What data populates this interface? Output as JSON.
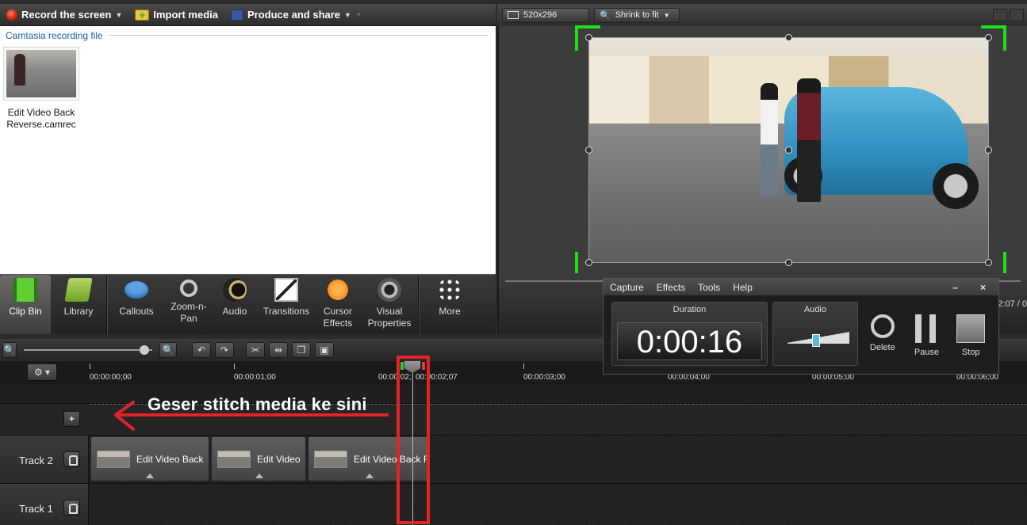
{
  "menubar": {
    "record_label": "Record the screen",
    "import_label": "Import media",
    "produce_label": "Produce and share"
  },
  "clipbin": {
    "header": "Camtasia recording file",
    "items": [
      {
        "name": "Edit Video Back Reverse.camrec"
      }
    ]
  },
  "tasks": [
    {
      "label": "Clip Bin",
      "icon": "film-strip-icon",
      "active": true
    },
    {
      "label": "Library",
      "icon": "library-folder-icon"
    },
    {
      "label": "Callouts",
      "icon": "callout-bubble-icon"
    },
    {
      "label": "Zoom-n-Pan",
      "icon": "magnifier-icon"
    },
    {
      "label": "Audio",
      "icon": "speaker-icon"
    },
    {
      "label": "Transitions",
      "icon": "transitions-icon"
    },
    {
      "label": "Cursor Effects",
      "icon": "cursor-icon"
    },
    {
      "label": "Visual Properties",
      "icon": "visual-properties-icon"
    },
    {
      "label": "More",
      "icon": "more-dots-icon"
    }
  ],
  "preview": {
    "size_label": "520x296",
    "zoom_label": "Shrink to fit"
  },
  "recorder": {
    "menu": [
      "Capture",
      "Effects",
      "Tools",
      "Help"
    ],
    "minimize": "–",
    "close": "×",
    "duration_label": "Duration",
    "duration_value": "0:00:16",
    "audio_label": "Audio",
    "delete_label": "Delete",
    "pause_label": "Pause",
    "stop_label": "Stop"
  },
  "timecode_peek": "2:07 / 0",
  "ruler": {
    "timecodes": [
      "00:00:00;00",
      "00:00:01;00",
      "00:00:02;",
      "00:00:02;07",
      "00:00:03;00",
      "00:00:04;00",
      "00:00:05;00",
      "00:00:06;00"
    ]
  },
  "annotation": {
    "text": "Geser stitch media ke sini"
  },
  "tracks": [
    {
      "name": "Track 2",
      "clips": [
        {
          "label": "Edit Video Back"
        },
        {
          "label": "Edit Video"
        },
        {
          "label": "Edit Video Back R"
        }
      ]
    },
    {
      "name": "Track 1",
      "clips": []
    }
  ],
  "colors": {
    "highlight": "#e0242a",
    "selection_handles": "#19e019",
    "link": "#1f5fa6"
  }
}
